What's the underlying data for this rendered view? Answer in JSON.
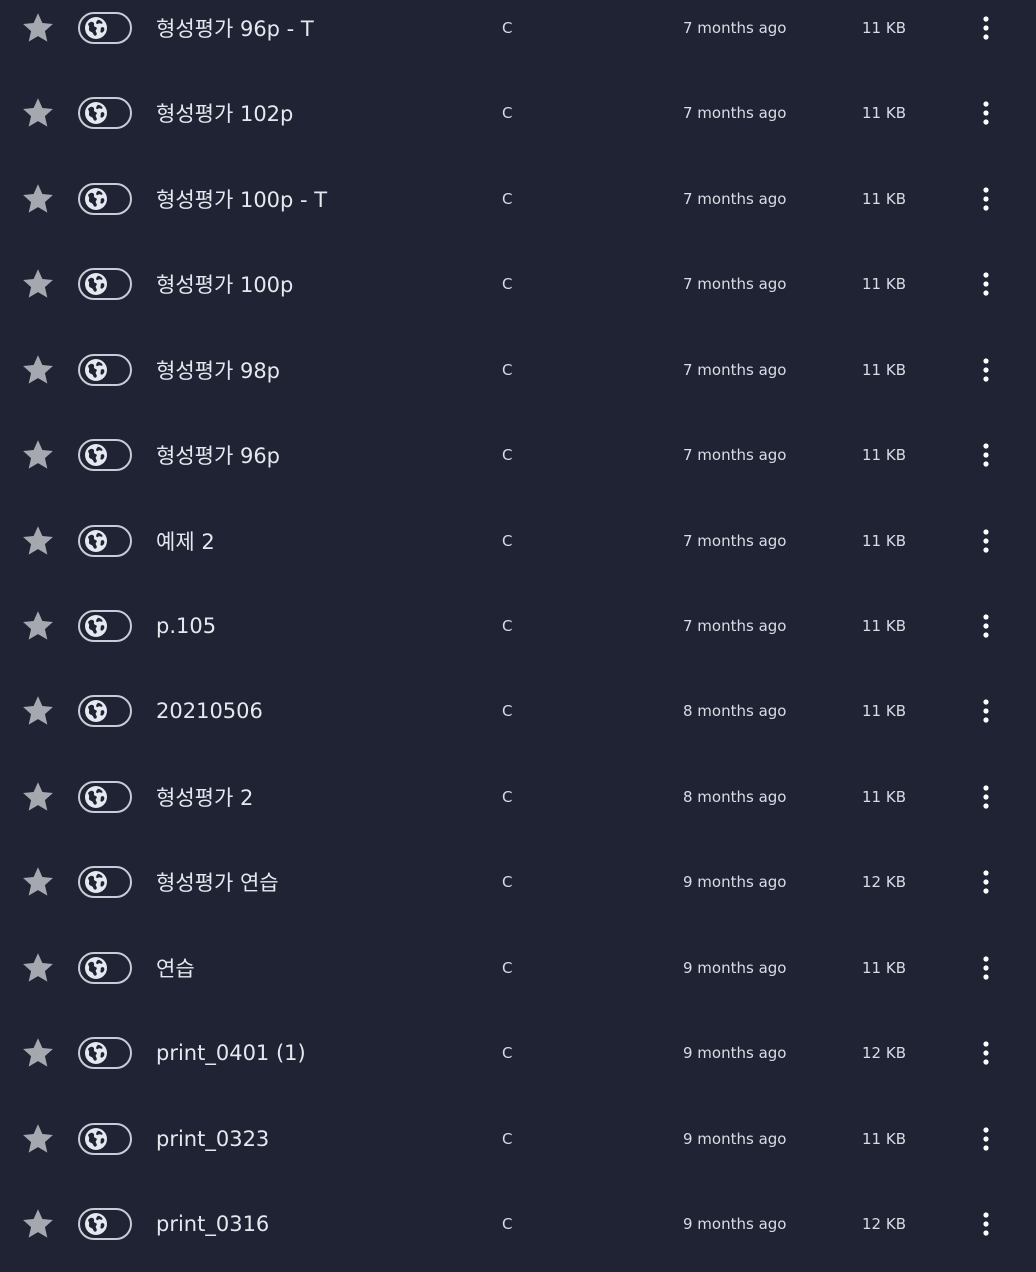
{
  "icons": {
    "star": "star-icon",
    "visibility": "globe-icon",
    "menu": "more-vertical-icon"
  },
  "colors": {
    "background": "#1f2333",
    "text": "#e6e8ef",
    "star": "#a6a8b0",
    "pill_border": "#c8ccd6"
  },
  "files": [
    {
      "title": "형성평가 96p - T",
      "lang": "C",
      "time": "7 months ago",
      "size": "11 KB"
    },
    {
      "title": "형성평가 102p",
      "lang": "C",
      "time": "7 months ago",
      "size": "11 KB"
    },
    {
      "title": "형성평가 100p - T",
      "lang": "C",
      "time": "7 months ago",
      "size": "11 KB"
    },
    {
      "title": "형성평가 100p",
      "lang": "C",
      "time": "7 months ago",
      "size": "11 KB"
    },
    {
      "title": "형성평가 98p",
      "lang": "C",
      "time": "7 months ago",
      "size": "11 KB"
    },
    {
      "title": "형성평가 96p",
      "lang": "C",
      "time": "7 months ago",
      "size": "11 KB"
    },
    {
      "title": "예제 2",
      "lang": "C",
      "time": "7 months ago",
      "size": "11 KB"
    },
    {
      "title": "p.105",
      "lang": "C",
      "time": "7 months ago",
      "size": "11 KB"
    },
    {
      "title": "20210506",
      "lang": "C",
      "time": "8 months ago",
      "size": "11 KB"
    },
    {
      "title": "형성평가 2",
      "lang": "C",
      "time": "8 months ago",
      "size": "11 KB"
    },
    {
      "title": "형성평가 연습",
      "lang": "C",
      "time": "9 months ago",
      "size": "12 KB"
    },
    {
      "title": "연습",
      "lang": "C",
      "time": "9 months ago",
      "size": "11 KB"
    },
    {
      "title": "print_0401 (1)",
      "lang": "C",
      "time": "9 months ago",
      "size": "12 KB"
    },
    {
      "title": "print_0323",
      "lang": "C",
      "time": "9 months ago",
      "size": "11 KB"
    },
    {
      "title": "print_0316",
      "lang": "C",
      "time": "9 months ago",
      "size": "12 KB"
    }
  ]
}
